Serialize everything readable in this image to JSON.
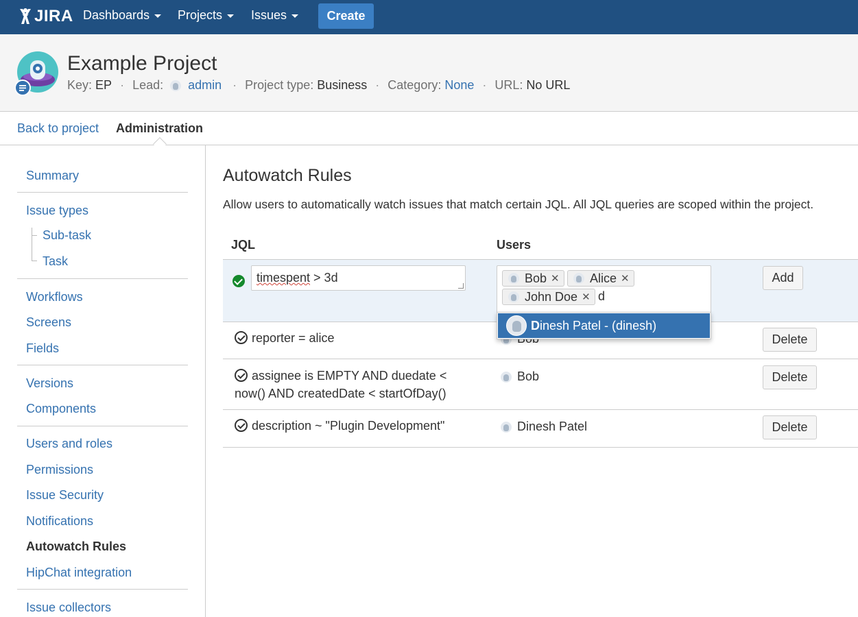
{
  "topnav": {
    "logo_text": "JIRA",
    "items": [
      {
        "label": "Dashboards"
      },
      {
        "label": "Projects"
      },
      {
        "label": "Issues"
      }
    ],
    "create_label": "Create",
    "brand_color": "#205081",
    "create_color": "#3b7fc4"
  },
  "project": {
    "title": "Example Project",
    "key_label": "Key:",
    "key": "EP",
    "lead_label": "Lead:",
    "lead": "admin",
    "type_label": "Project type:",
    "type": "Business",
    "category_label": "Category:",
    "category": "None",
    "url_label": "URL:",
    "url": "No URL"
  },
  "subnav": {
    "back": "Back to project",
    "admin": "Administration"
  },
  "sidebar": {
    "items": [
      {
        "label": "Summary"
      },
      {
        "label": "Issue types"
      },
      {
        "label": "Sub-task"
      },
      {
        "label": "Task"
      },
      {
        "label": "Workflows"
      },
      {
        "label": "Screens"
      },
      {
        "label": "Fields"
      },
      {
        "label": "Versions"
      },
      {
        "label": "Components"
      },
      {
        "label": "Users and roles"
      },
      {
        "label": "Permissions"
      },
      {
        "label": "Issue Security"
      },
      {
        "label": "Notifications"
      },
      {
        "label": "Autowatch Rules"
      },
      {
        "label": "HipChat integration"
      },
      {
        "label": "Issue collectors"
      }
    ],
    "active": "Autowatch Rules"
  },
  "main": {
    "title": "Autowatch Rules",
    "description": "Allow users to automatically watch issues that match certain JQL. All JQL queries are scoped within the project.",
    "col_jql": "JQL",
    "col_users": "Users",
    "edit": {
      "jql_word": "timespent",
      "jql_rest": " > 3d",
      "users": [
        "Bob",
        "Alice",
        "John Doe"
      ],
      "typed": "d",
      "add_label": "Add"
    },
    "rules": [
      {
        "jql": "reporter = alice",
        "user": "Bob",
        "delete_label": "Delete"
      },
      {
        "jql_line1": "assignee is EMPTY AND duedate <",
        "jql_line2": "now() AND createdDate < startOfDay()",
        "user": "Bob",
        "delete_label": "Delete"
      },
      {
        "jql": "description ~ \"Plugin Development\"",
        "user": "Dinesh Patel",
        "delete_label": "Delete"
      }
    ],
    "suggestion": {
      "match": "D",
      "rest": "inesh Patel - (dinesh)"
    }
  }
}
